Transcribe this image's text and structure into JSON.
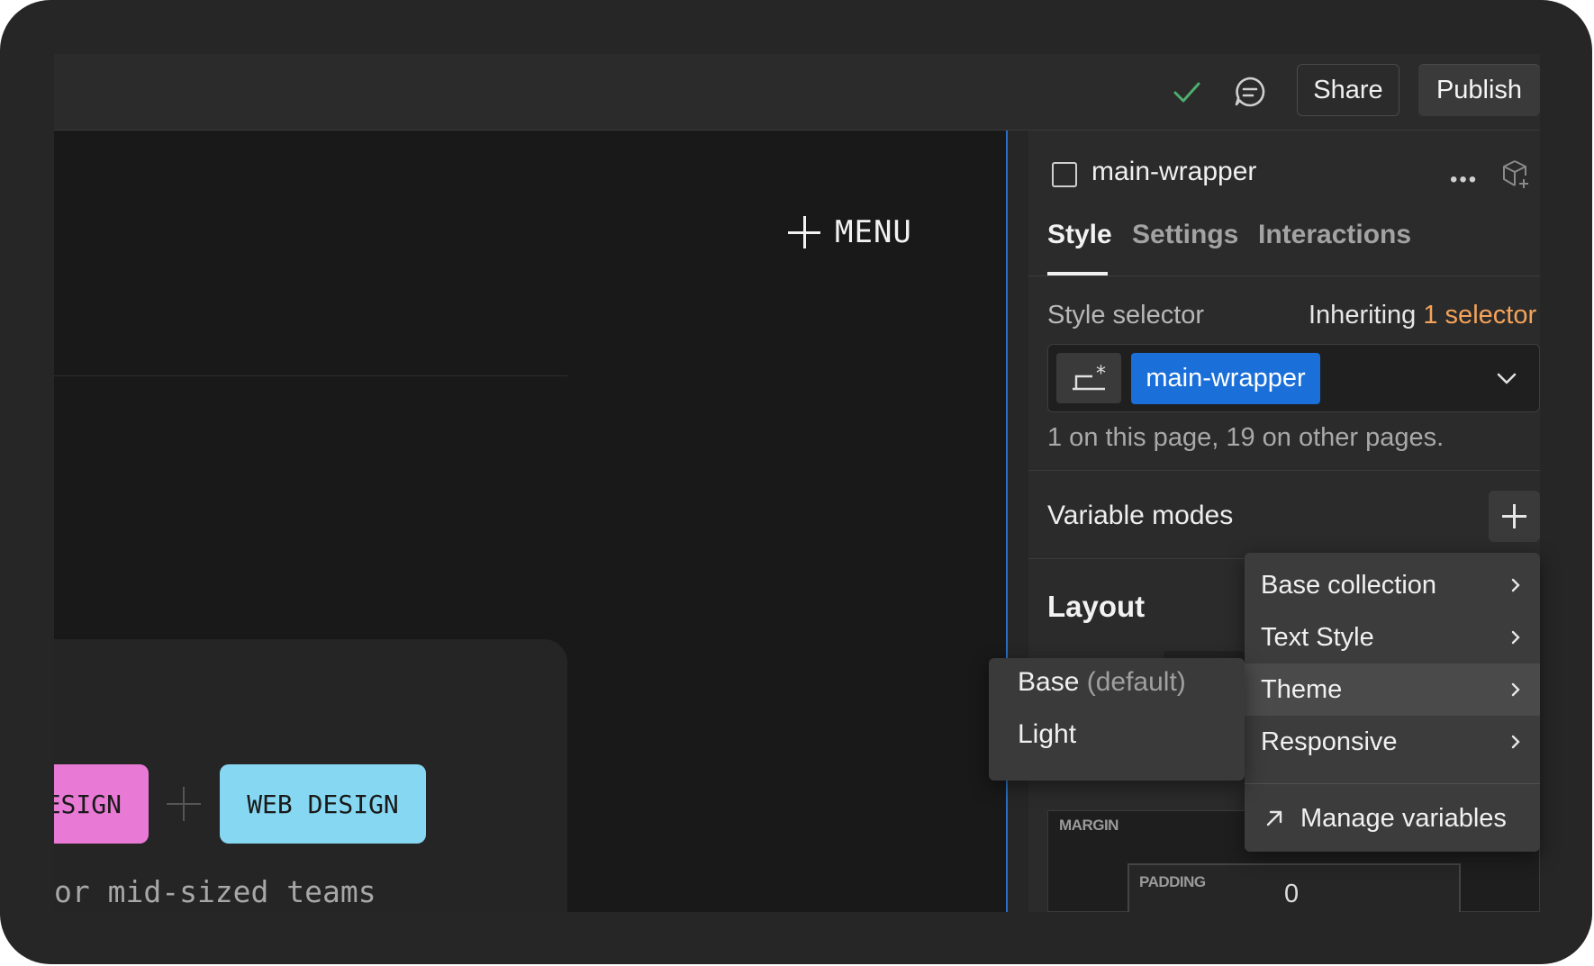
{
  "topbar": {
    "status_icon": "check-icon",
    "comment_icon": "comment-icon",
    "share_label": "Share",
    "publish_label": "Publish"
  },
  "canvas": {
    "menu_label": "MENU",
    "tags": [
      "ESIGN",
      "WEB DESIGN"
    ],
    "caption": "or mid-sized teams"
  },
  "panel": {
    "element_name": "main-wrapper",
    "tabs": [
      {
        "label": "Style",
        "active": true
      },
      {
        "label": "Settings",
        "active": false
      },
      {
        "label": "Interactions",
        "active": false
      }
    ],
    "style_selector": {
      "label": "Style selector",
      "inheriting_prefix": "Inheriting",
      "inheriting_count": "1 selector",
      "chip": "main-wrapper",
      "note": "1 on this page, 19 on other pages."
    },
    "variable_modes_label": "Variable modes",
    "layout_label": "Layout",
    "box_model": {
      "margin_label": "MARGIN",
      "padding_label": "PADDING",
      "padding_value": "0"
    }
  },
  "dropdown": {
    "items": [
      {
        "label": "Base collection"
      },
      {
        "label": "Text Style"
      },
      {
        "label": "Theme",
        "highlighted": true
      },
      {
        "label": "Responsive"
      }
    ],
    "manage_label": "Manage variables"
  },
  "submenu": {
    "items": [
      {
        "label": "Base",
        "suffix": "(default)"
      },
      {
        "label": "Light",
        "suffix": ""
      }
    ]
  },
  "colors": {
    "accent_blue": "#1a6fd8",
    "inherit_orange": "#f4a35a",
    "check_green": "#4caf6e",
    "tag_pink": "#e87ad6",
    "tag_blue": "#86d8f2"
  }
}
